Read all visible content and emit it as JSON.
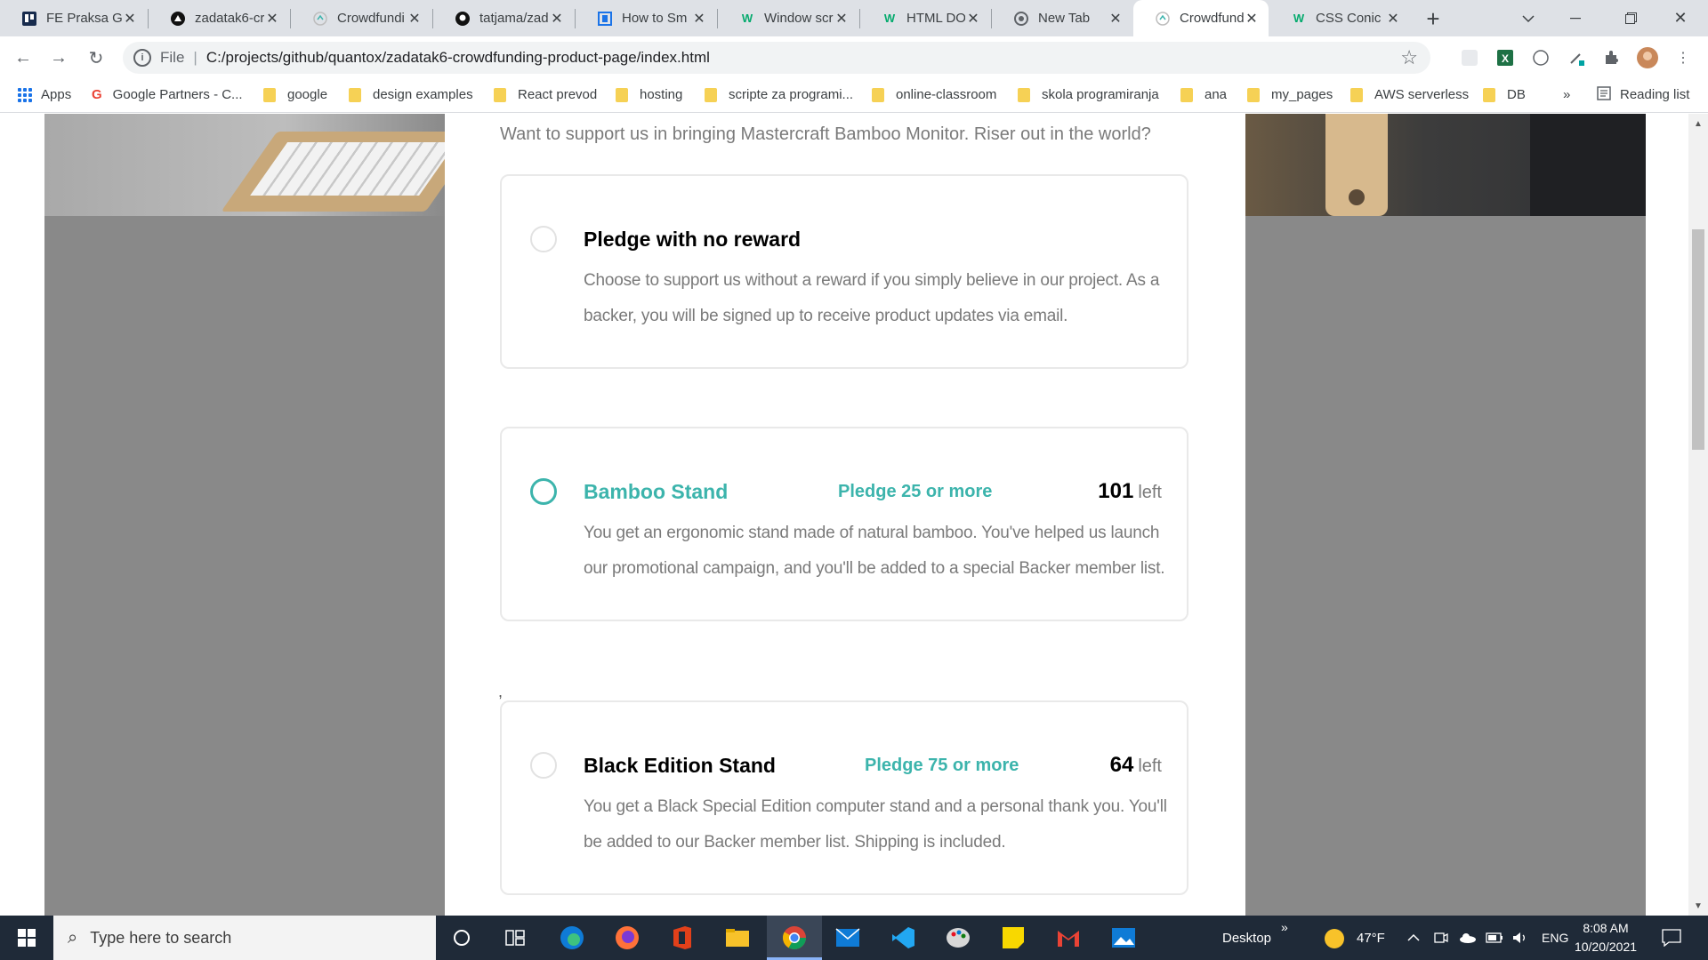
{
  "tabs": [
    {
      "title": "FE Praksa G",
      "icon": "trello-icon",
      "color": "#172b4d"
    },
    {
      "title": "zadatak6-cr",
      "icon": "netlify-icon",
      "color": "#111111"
    },
    {
      "title": "Crowdfundi",
      "icon": "crowdfund-icon",
      "color": "#9aa0a6"
    },
    {
      "title": "tatjama/zad",
      "icon": "github-icon",
      "color": "#111111"
    },
    {
      "title": "How to Sm",
      "icon": "book-icon",
      "color": "#1a73e8"
    },
    {
      "title": "Window scr",
      "icon": "w3-icon",
      "color": "#04aa6d"
    },
    {
      "title": "HTML DOM",
      "icon": "w3-icon",
      "color": "#04aa6d"
    },
    {
      "title": "New Tab",
      "icon": "chrome-icon",
      "color": "#5f6368"
    },
    {
      "title": "Crowdfundi",
      "icon": "crowdfund-icon",
      "color": "#9aa0a6"
    },
    {
      "title": "CSS Conic G",
      "icon": "w3-icon",
      "color": "#04aa6d"
    }
  ],
  "omnibox": {
    "scheme": "File",
    "url": "C:/projects/github/quantox/zadatak6-crowdfunding-product-page/index.html"
  },
  "bookmarks": {
    "apps_label": "Apps",
    "items": [
      "Google Partners - C...",
      "google",
      "design examples",
      "React prevod",
      "hosting",
      "scripte za programi...",
      "online-classroom",
      "skola programiranja",
      "ana",
      "my_pages",
      "AWS serverless",
      "DB"
    ],
    "overflow": "»",
    "reading_list": "Reading list"
  },
  "page": {
    "intro": "Want to support us in bringing Mastercraft Bamboo Monitor. Riser out in the world?",
    "stray_char": ",",
    "accent_color": "#3cb4ac",
    "cards": [
      {
        "title": "Pledge with no reward",
        "pledge": "",
        "left_count": "",
        "left_label": "",
        "description": "Choose to support us without a reward if you simply believe in our project. As a backer, you will be signed up to receive product updates via email."
      },
      {
        "title": "Bamboo Stand",
        "pledge": "Pledge 25 or more",
        "left_count": "101",
        "left_label": "left",
        "description": "You get an ergonomic stand made of natural bamboo. You've helped us launch our promotional campaign, and you'll be added to a special Backer member list."
      },
      {
        "title": "Black Edition Stand",
        "pledge": "Pledge 75 or more",
        "left_count": "64",
        "left_label": "left",
        "description": "You get a Black Special Edition computer stand and a personal thank you. You'll be added to our Backer member list. Shipping is included."
      }
    ]
  },
  "taskbar": {
    "search_placeholder": "Type here to search",
    "desktop_label": "Desktop",
    "chevron": "»",
    "weather": "47°F",
    "language": "ENG",
    "time": "8:08 AM",
    "date": "10/20/2021"
  }
}
